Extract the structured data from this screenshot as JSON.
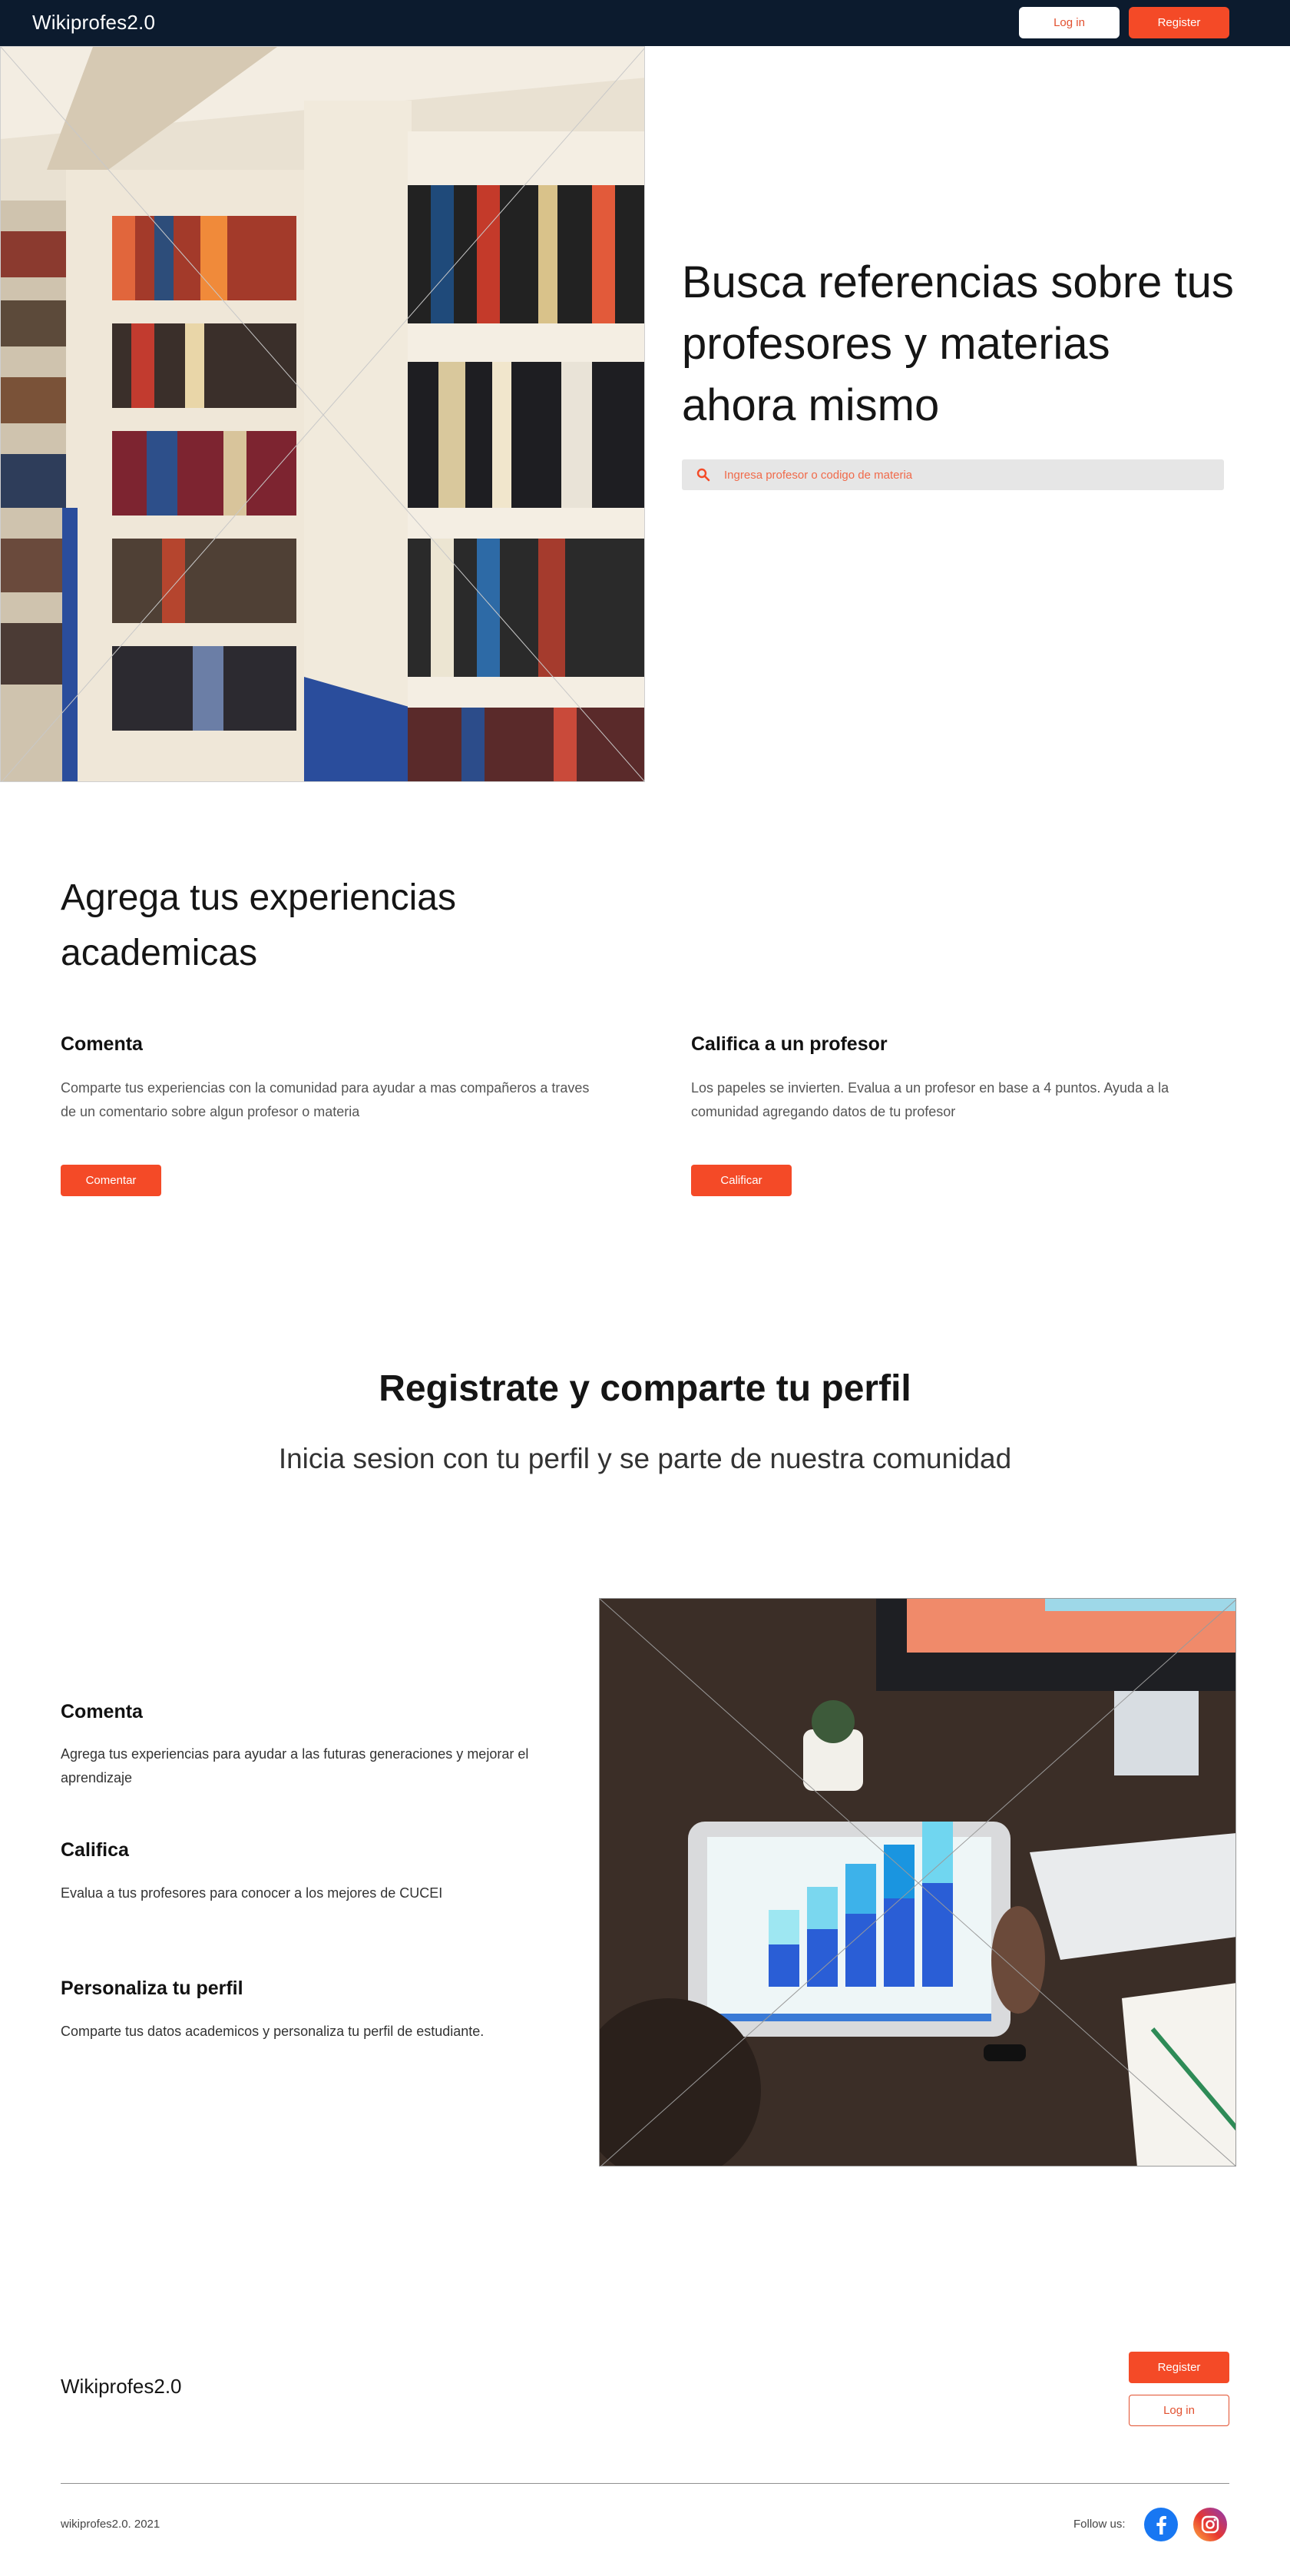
{
  "navbar": {
    "brand": "Wikiprofes2.0",
    "login_label": "Log in",
    "register_label": "Register"
  },
  "hero": {
    "title": "Busca referencias sobre tus profesores y materias ahora mismo",
    "search_placeholder": "Ingresa profesor o codigo de materia",
    "image": "library-bookshelves-photo"
  },
  "experiences": {
    "title": "Agrega tus experiencias academicas",
    "features": [
      {
        "title": "Comenta",
        "text": "Comparte tus experiencias con la comunidad para ayudar a mas compañeros a traves de un comentario sobre algun profesor o materia",
        "button": "Comentar"
      },
      {
        "title": "Califica a un profesor",
        "text": "Los papeles se invierten. Evalua a un profesor en base a 4 puntos. Ayuda a la comunidad agregando datos de tu profesor",
        "button": "Calificar"
      }
    ]
  },
  "register": {
    "title": "Registrate y comparte tu perfil",
    "subtitle": "Inicia sesion con tu perfil y se parte de nuestra comunidad"
  },
  "benefits": {
    "items": [
      {
        "title": "Comenta",
        "text": "Agrega tus experiencias para ayudar a las futuras generaciones y mejorar el aprendizaje"
      },
      {
        "title": "Califica",
        "text": "Evalua a tus profesores para conocer a los mejores de CUCEI"
      },
      {
        "title": "Personaliza tu perfil",
        "text": "Comparte tus datos academicos y personaliza tu perfil de estudiante."
      }
    ],
    "image": "tablet-chart-photo"
  },
  "footer": {
    "brand": "Wikiprofes2.0",
    "register_label": "Register",
    "login_label": "Log in",
    "copyright": "wikiprofes2.0. 2021",
    "follow_label": "Follow us:",
    "social": [
      "facebook-icon",
      "instagram-icon"
    ]
  },
  "colors": {
    "navbar_bg": "#0c1b2e",
    "accent": "#f44a27",
    "search_bg": "#e6e6e6"
  }
}
